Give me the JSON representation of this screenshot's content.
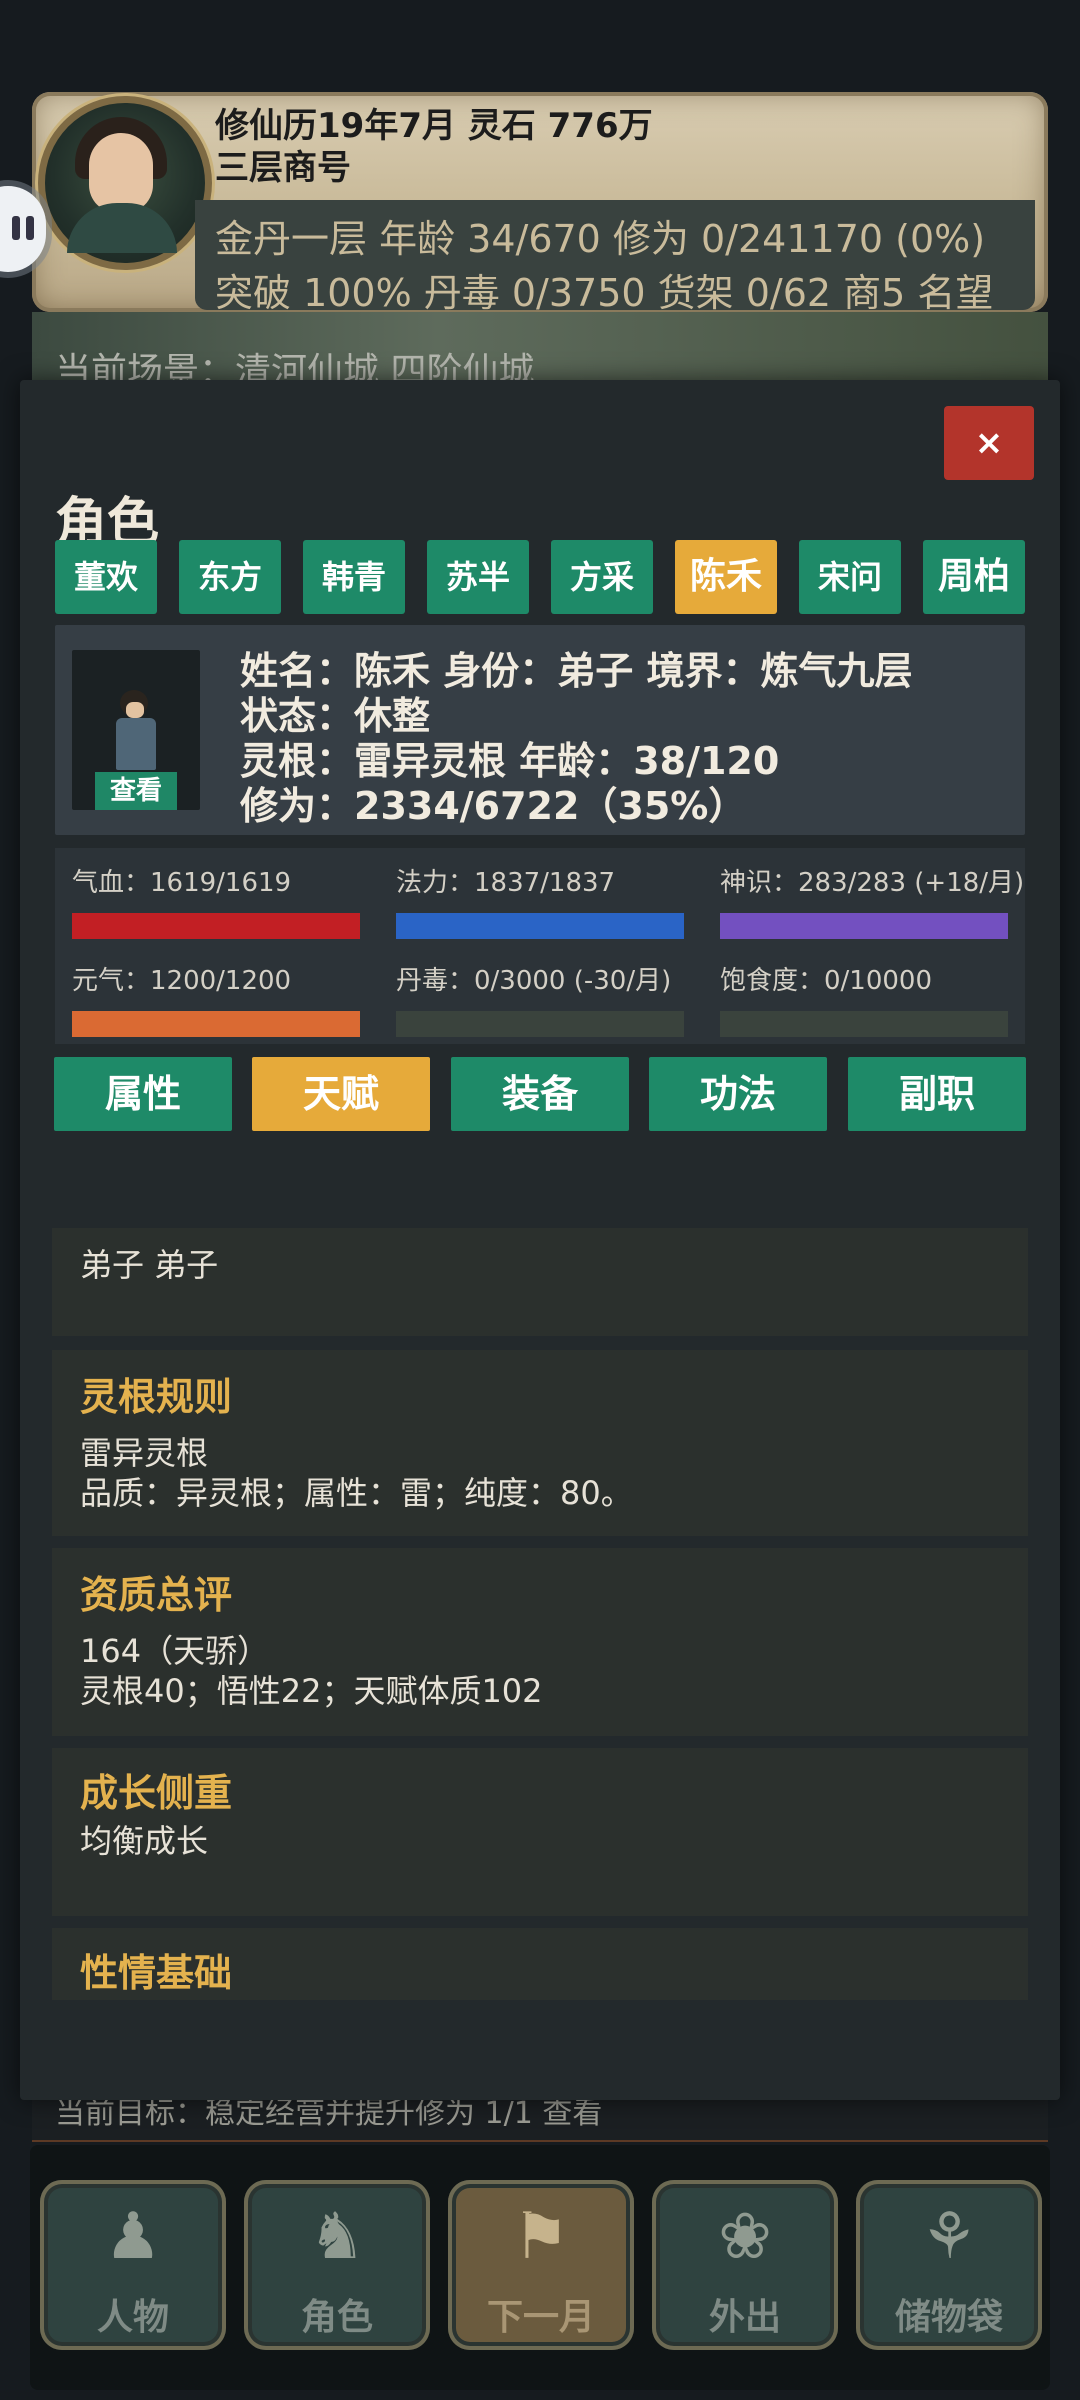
{
  "header": {
    "date_stone": "修仙历19年7月    灵石 776万",
    "shop_level": "三层商号",
    "stats_line1": "金丹一层    年龄 34/670    修为 0/241170 (0%)",
    "stats_line2": "突破 100%    丹毒 0/3750    货架 0/62    商5    名望",
    "scene": "当前场景：清河仙城   四阶仙城",
    "goal": "当前目标：稳定经营并提升修为 1/1    查看"
  },
  "modal": {
    "close_label": "×",
    "title": "角色",
    "characters": [
      "董欢",
      "东方",
      "韩青",
      "苏半",
      "方采",
      "陈禾",
      "宋问",
      "周柏"
    ],
    "selected_character": "陈禾",
    "info": {
      "view_label": "查看",
      "line1": "姓名：陈禾    身份：弟子    境界：炼气九层",
      "line2": "状态：休整",
      "line3": "灵根：雷异灵根    年龄：38/120",
      "line4": "修为：2334/6722（35%）"
    },
    "stats": [
      {
        "label": "气血：1619/1619",
        "fill": 1.0,
        "color": "#c21f24"
      },
      {
        "label": "法力：1837/1837",
        "fill": 1.0,
        "color": "#2a64c6"
      },
      {
        "label": "神识：283/283 (+18/月)",
        "fill": 1.0,
        "color": "#7350c0"
      },
      {
        "label": "元气：1200/1200",
        "fill": 1.0,
        "color": "#da6a33"
      },
      {
        "label": "丹毒：0/3000 (-30/月)",
        "fill": 0.0,
        "color": "#3e4a3f"
      },
      {
        "label": "饱食度：0/10000",
        "fill": 0.0,
        "color": "#3e4a3f"
      }
    ],
    "sections": [
      "属性",
      "天赋",
      "装备",
      "功法",
      "副职"
    ],
    "selected_section": "天赋",
    "panels": {
      "identity": "弟子    弟子",
      "root_title": "灵根规则",
      "root_line1": "雷异灵根",
      "root_line2": "品质：异灵根；属性：雷；纯度：80。",
      "aptitude_title": "资质总评",
      "aptitude_line1": "164（天骄）",
      "aptitude_line2": "灵根40；悟性22；天赋体质102",
      "growth_title": "成长侧重",
      "growth_line1": "均衡成长",
      "temper_title": "性情基础"
    }
  },
  "nav": {
    "items": [
      {
        "label": "人物",
        "icon": "person-icon"
      },
      {
        "label": "角色",
        "icon": "disciple-icon"
      },
      {
        "label": "下一月",
        "icon": "flag-icon"
      },
      {
        "label": "外出",
        "icon": "lotus-icon"
      },
      {
        "label": "储物袋",
        "icon": "bag-icon"
      }
    ]
  }
}
